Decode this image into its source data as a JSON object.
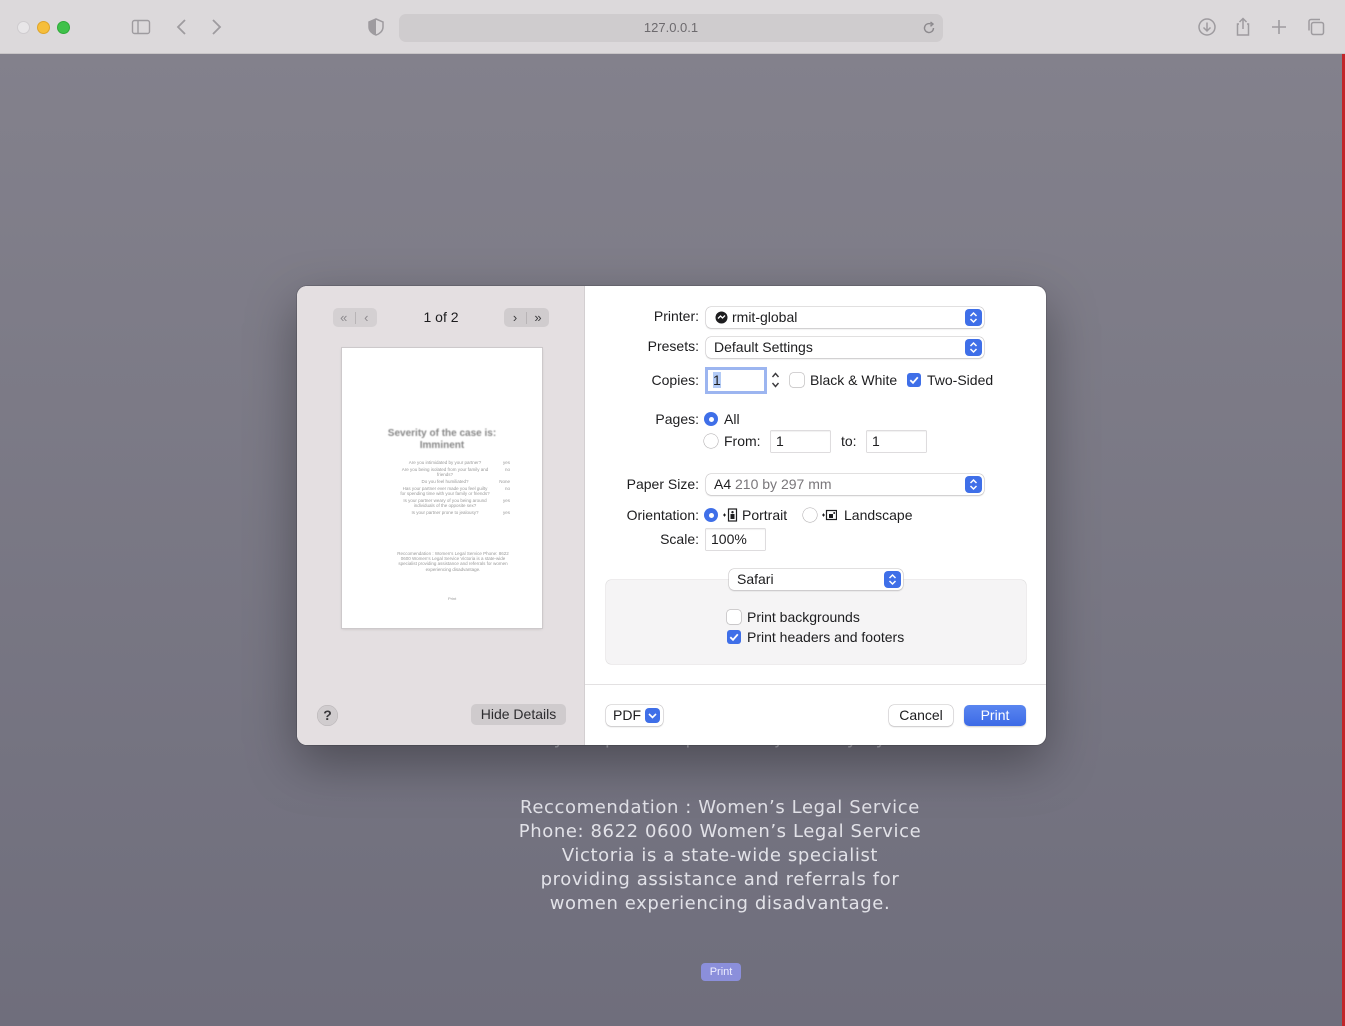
{
  "browser": {
    "url": "127.0.0.1"
  },
  "background_page": {
    "faded_line": "Is your partner prone to jealousy?   yes",
    "recommendation_lines": [
      "Reccomendation : Women’s Legal Service",
      "Phone: 8622 0600 Women’s Legal Service",
      "Victoria is a state-wide specialist",
      "providing assistance and referrals for",
      "women experiencing disadvantage."
    ],
    "print_button": "Print"
  },
  "preview": {
    "page_indicator": "1 of 2",
    "thumbnail": {
      "title": "Severity of the case is: Imminent",
      "questions": [
        {
          "q": "Are you intimidated by your partner?",
          "a": "yes"
        },
        {
          "q": "Are you being isolated from your family and friends?",
          "a": "no"
        },
        {
          "q": "Do you feel humiliated?",
          "a": "None"
        },
        {
          "q": "Has your partner ever made you feel guilty for spending time with your family or friends?",
          "a": "no"
        },
        {
          "q": "Is your partner weary of you being around individuals of the opposite sex?",
          "a": "yes"
        },
        {
          "q": "Is your partner prone to jealousy?",
          "a": "yes"
        }
      ],
      "recommendation": "Reccomendation : Women’s Legal Service Phone: 8622 0600 Women’s Legal Service Victoria is a state-wide specialist providing assistance and referrals for women experiencing disadvantage.",
      "button": "Print"
    },
    "help_label": "?",
    "hide_details_label": "Hide Details"
  },
  "settings": {
    "printer_label": "Printer:",
    "printer_value": "rmit-global",
    "presets_label": "Presets:",
    "presets_value": "Default Settings",
    "copies_label": "Copies:",
    "copies_value": "1",
    "black_white_label": "Black & White",
    "black_white_checked": false,
    "two_sided_label": "Two-Sided",
    "two_sided_checked": true,
    "pages_label": "Pages:",
    "pages_all_label": "All",
    "pages_from_label": "From:",
    "pages_from_value": "1",
    "pages_to_label": "to:",
    "pages_to_value": "1",
    "paper_size_label": "Paper Size:",
    "paper_size_value": "A4",
    "paper_size_detail": "210 by 297 mm",
    "orientation_label": "Orientation:",
    "portrait_label": "Portrait",
    "landscape_label": "Landscape",
    "scale_label": "Scale:",
    "scale_value": "100%",
    "app_section_value": "Safari",
    "print_backgrounds_label": "Print backgrounds",
    "print_backgrounds_checked": false,
    "print_headers_footers_label": "Print headers and footers",
    "print_headers_footers_checked": true
  },
  "footer": {
    "pdf_label": "PDF",
    "cancel_label": "Cancel",
    "print_label": "Print"
  },
  "colors": {
    "accent": "#3f6fe8",
    "overlay": "#7b7a86"
  }
}
